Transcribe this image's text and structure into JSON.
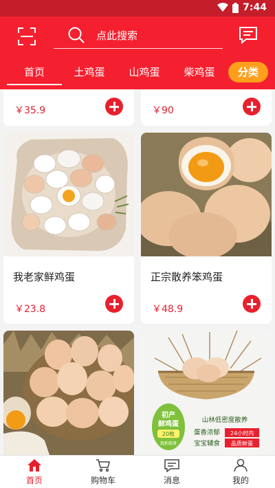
{
  "status_bar": {
    "time": "7:44"
  },
  "search": {
    "placeholder": "点此搜索"
  },
  "tabs": [
    {
      "label": "首页",
      "active": true
    },
    {
      "label": "土鸡蛋"
    },
    {
      "label": "山鸡蛋"
    },
    {
      "label": "柴鸡蛋"
    }
  ],
  "category_button": "分类",
  "products": [
    {
      "price": "￥35.9"
    },
    {
      "price": "￥90"
    },
    {
      "title": "我老家鲜鸡蛋",
      "price": "￥23.8"
    },
    {
      "title": "正宗散养笨鸡蛋",
      "price": "￥48.9"
    },
    {
      "title": "",
      "price": ""
    },
    {
      "title": "",
      "price": ""
    }
  ],
  "product_badges": {
    "badge_line1": "初产",
    "badge_line2": "鲜鸡蛋",
    "badge_count": "20枚",
    "badge_small": "现拍现发",
    "slogan_1": "山林低密度散养",
    "slogan_2": "蛋香浓郁",
    "slogan_3": "宝宝辅食",
    "tag_1": "24小时内",
    "tag_2": "品质鲜蛋"
  },
  "bottom_nav": [
    {
      "label": "首页",
      "icon": "home-icon",
      "active": true
    },
    {
      "label": "购物车",
      "icon": "cart-icon"
    },
    {
      "label": "消息",
      "icon": "message-icon"
    },
    {
      "label": "我的",
      "icon": "user-icon"
    }
  ],
  "colors": {
    "brand_red": "#f4202f",
    "status_red": "#c41e2b",
    "price_red": "#e0202e",
    "category_orange": "#ff9f1c"
  }
}
